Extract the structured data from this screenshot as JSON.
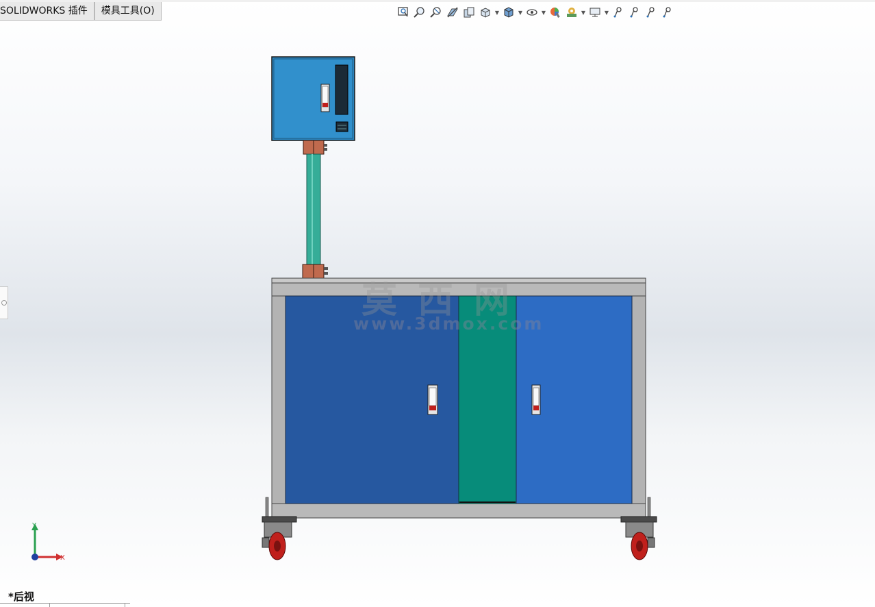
{
  "tabs": [
    {
      "label": "SOLIDWORKS 插件"
    },
    {
      "label": "模具工具(O)"
    }
  ],
  "toolbar": {
    "icons": [
      "zoom-to-fit-icon",
      "zoom-to-area-icon",
      "previous-view-icon",
      "section-view-icon",
      "dynamic-annotation-icon",
      "view-orientation-icon",
      "display-style-icon",
      "hide-show-items-icon",
      "edit-appearance-icon",
      "apply-scene-icon",
      "view-settings-icon",
      "heads-up-view-1-icon",
      "heads-up-view-2-icon",
      "heads-up-view-3-icon",
      "heads-up-view-4-icon"
    ]
  },
  "watermark": {
    "text_cn": "莫西网",
    "url": "www.3dmox.com"
  },
  "triad": {
    "y_label": "Y",
    "x_label": "X"
  },
  "view_label": "*后视",
  "colors": {
    "door_left": "#2658a0",
    "door_right": "#2d6cc4",
    "center_panel": "#078c7a",
    "frame": "#b3b3b3",
    "pole": "#36ad98",
    "clamp": "#c06a4e",
    "box": "#2b86c0",
    "wheel": "#c0201c"
  }
}
